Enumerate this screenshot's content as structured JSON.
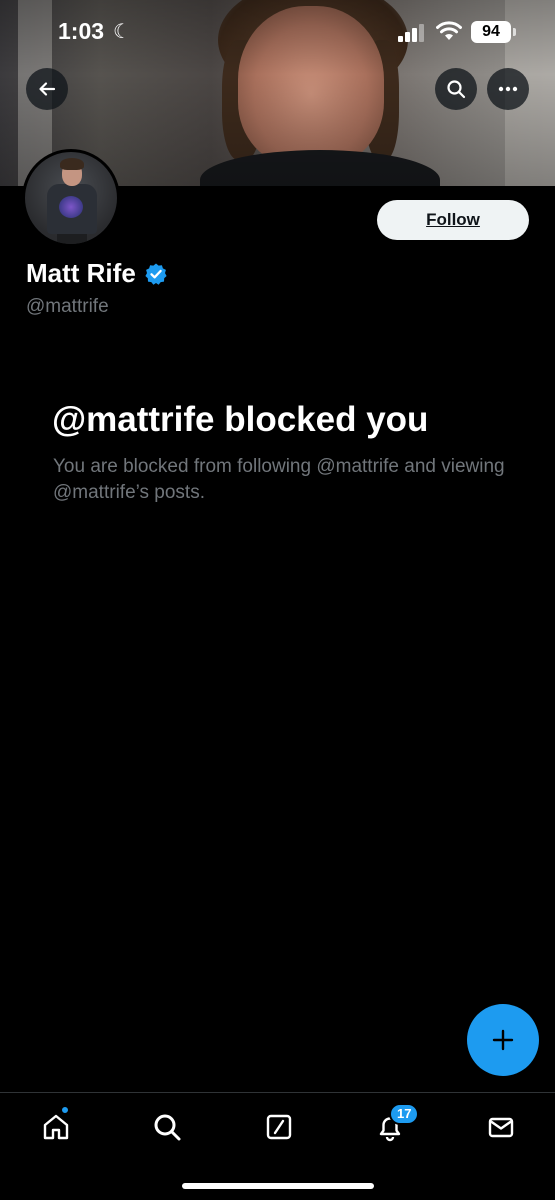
{
  "status_bar": {
    "time": "1:03",
    "battery": "94"
  },
  "profile": {
    "display_name": "Matt Rife",
    "handle": "@mattrife",
    "verified": true,
    "follow_label": "Follow"
  },
  "blocked": {
    "title": "@mattrife blocked you",
    "body": "You are blocked from following @mattrife and viewing @mattrife’s posts."
  },
  "nav": {
    "items": [
      "home",
      "explore",
      "grok",
      "notifications",
      "messages"
    ],
    "notification_count": "17"
  },
  "colors": {
    "accent": "#1d9bf0",
    "background": "#000000",
    "secondary_text": "#71767b"
  },
  "icons": [
    "back-arrow-icon",
    "search-icon",
    "more-icon",
    "verified-badge-icon",
    "plus-icon",
    "home-icon",
    "explore-icon",
    "grok-icon",
    "notifications-bell-icon",
    "messages-icon",
    "moon-icon",
    "signal-icon",
    "wifi-icon"
  ]
}
